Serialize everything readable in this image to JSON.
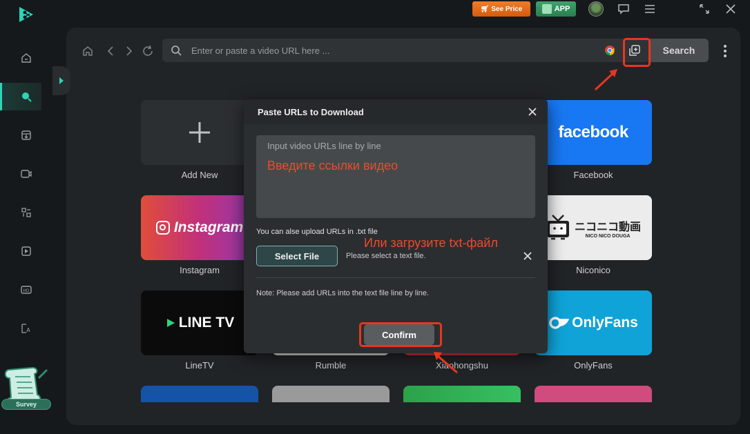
{
  "top_bar": {
    "see_price_label": "See Price",
    "app_label": "APP"
  },
  "sidebar": {
    "items": [
      "home-icon",
      "search-icon",
      "download-icon",
      "video-convert-icon",
      "toolkit-icon",
      "video-edit-icon",
      "hd-icon",
      "translate-icon"
    ],
    "active_index": 1,
    "survey_label": "Survey"
  },
  "browser": {
    "url_placeholder": "Enter or paste a video URL here ...",
    "search_label": "Search"
  },
  "tiles": [
    {
      "label": "Add New",
      "logo": "+",
      "bg": "#2c2f32"
    },
    {
      "label": "Facebook",
      "logo": "facebook",
      "bg": "#1877f2"
    },
    {
      "label": "Instagram",
      "logo": "Instagram",
      "bg": "linear"
    },
    {
      "label": "Niconico",
      "logo": "ニコニコ動画",
      "logo_sub": "NICO NICO DOUGA",
      "bg": "#ececec"
    },
    {
      "label": "LineTV",
      "logo": "LINE TV",
      "bg": "#0b0b0b"
    },
    {
      "label": "Rumble",
      "bg": "#e2e2e2"
    },
    {
      "label": "Xiaohongshu",
      "bg": "#e52c3c"
    },
    {
      "label": "OnlyFans",
      "logo": "OnlyFans",
      "bg": "#0fa3d8"
    }
  ],
  "dialog": {
    "title": "Paste URLs to Download",
    "textarea_placeholder": "Input video URLs line by line",
    "annotation_input": "Введите ссылки видео",
    "upload_hint": "You can alse upload URLs in .txt file",
    "select_file_label": "Select File",
    "file_status": "Please select a text file.",
    "annotation_upload": "Или загрузите txt-файл",
    "note": "Note: Please add URLs into the text file line by line.",
    "confirm_label": "Confirm"
  },
  "colors": {
    "accent": "#2fd3b6",
    "annotation_red": "#e8361f"
  }
}
